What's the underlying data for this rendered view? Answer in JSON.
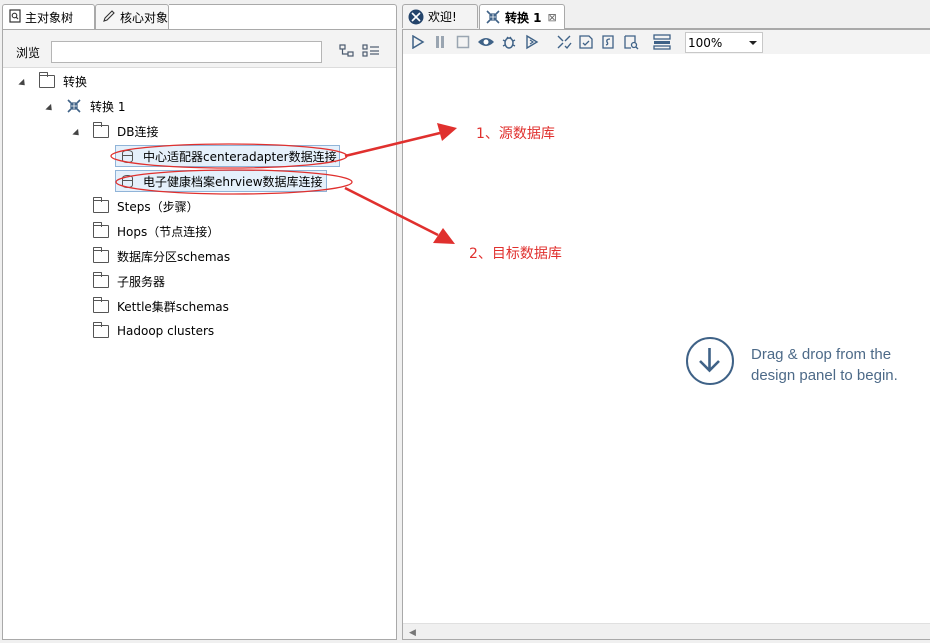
{
  "left_panel": {
    "tabs": [
      {
        "label": "主对象树",
        "icon": "search-doc-icon"
      },
      {
        "label": "核心对象",
        "icon": "pencil-icon"
      }
    ],
    "browse_label": "浏览",
    "browse_value": "",
    "tree": {
      "root": "转换",
      "transform": "转换 1",
      "db_folder": "DB连接",
      "db_connections": [
        "中心适配器centeradapter数据连接",
        "电子健康档案ehrview数据库连接"
      ],
      "folders": [
        "Steps（步骤）",
        "Hops（节点连接）",
        "数据库分区schemas",
        "子服务器",
        "Kettle集群schemas",
        "Hadoop clusters"
      ]
    }
  },
  "right_panel": {
    "tabs": [
      {
        "label": "欢迎!",
        "icon": "spoon-logo-icon"
      },
      {
        "label": "转换 1",
        "icon": "transform-icon",
        "active": true
      }
    ],
    "toolbar": {
      "icons": [
        "run-icon",
        "pause-icon",
        "stop-icon",
        "preview-icon",
        "debug-icon",
        "replay-icon",
        "verify-icon",
        "analyze-icon",
        "sql-icon",
        "explore-db-icon",
        "show-results-icon"
      ],
      "zoom": "100%"
    },
    "canvas_hint": "Drag & drop from the design panel to begin."
  },
  "annotations": {
    "source": "1、源数据库",
    "target": "2、目标数据库",
    "color": "#e0302e"
  }
}
